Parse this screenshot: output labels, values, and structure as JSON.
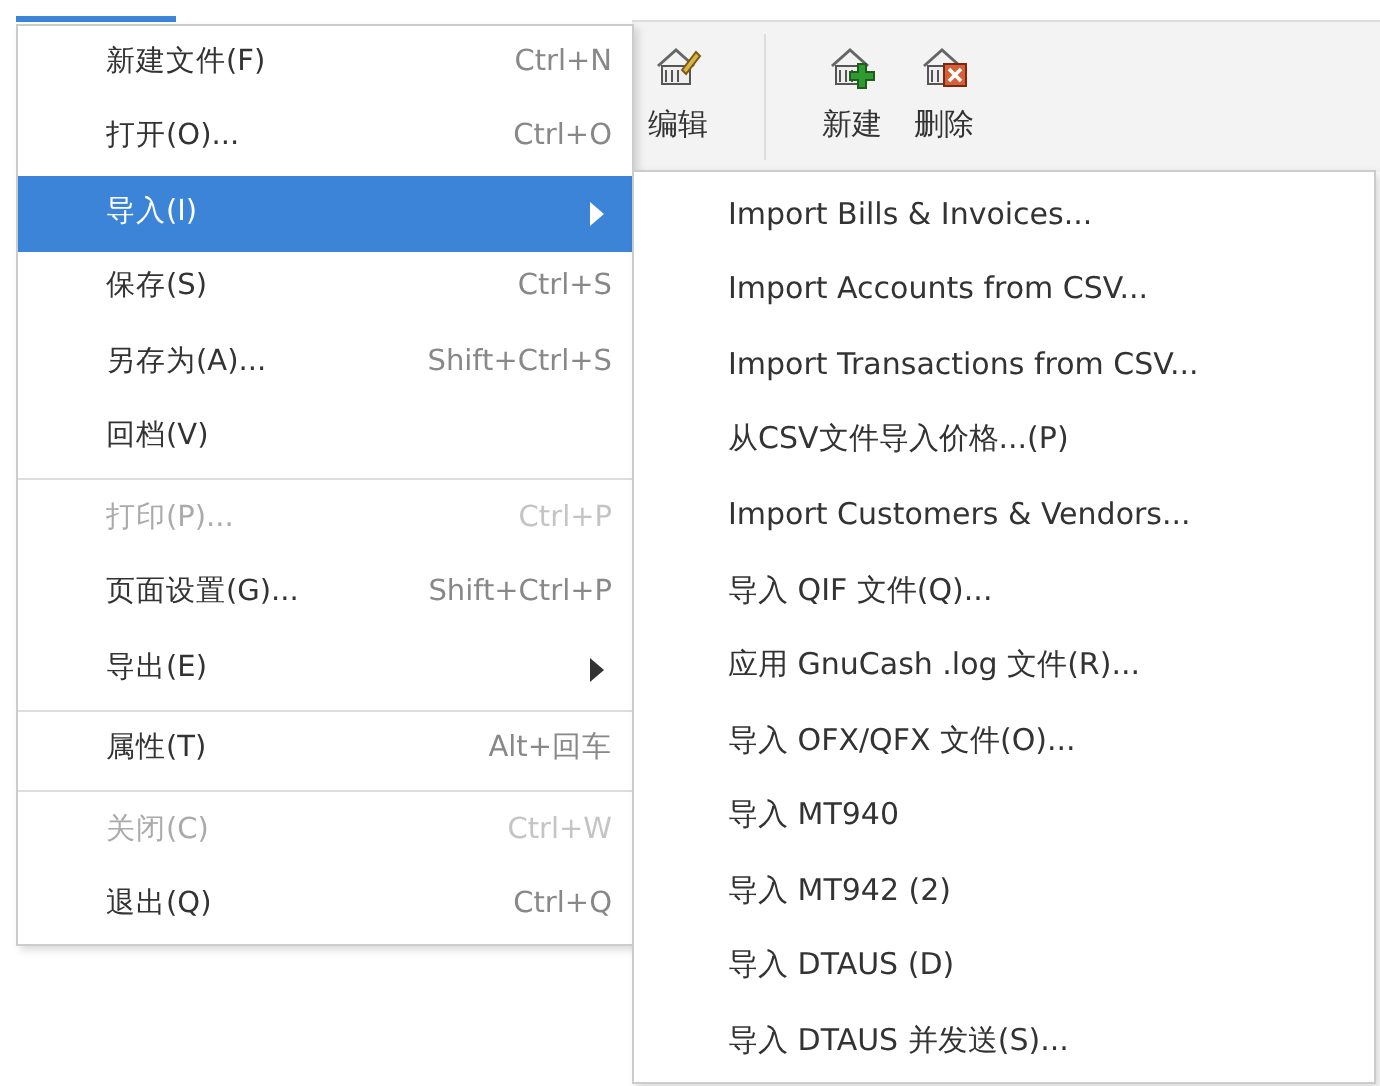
{
  "toolbar": {
    "buttons": [
      {
        "label": "编辑"
      },
      {
        "label": "新建"
      },
      {
        "label": "删除"
      }
    ]
  },
  "menu": {
    "items": [
      {
        "kind": "item",
        "label": "新建文件(F)",
        "shortcut": "Ctrl+N",
        "disabled": false,
        "selected": false
      },
      {
        "kind": "item",
        "label": "打开(O)...",
        "shortcut": "Ctrl+O",
        "disabled": false,
        "selected": false
      },
      {
        "kind": "submenu",
        "label": "导入(I)",
        "disabled": false,
        "selected": true
      },
      {
        "kind": "item",
        "label": "保存(S)",
        "shortcut": "Ctrl+S",
        "disabled": false,
        "selected": false
      },
      {
        "kind": "item",
        "label": "另存为(A)...",
        "shortcut": "Shift+Ctrl+S",
        "disabled": false,
        "selected": false
      },
      {
        "kind": "item",
        "label": "回档(V)",
        "disabled": false,
        "selected": false
      },
      {
        "kind": "separator"
      },
      {
        "kind": "item",
        "label": "打印(P)...",
        "shortcut": "Ctrl+P",
        "disabled": true,
        "selected": false
      },
      {
        "kind": "item",
        "label": "页面设置(G)...",
        "shortcut": "Shift+Ctrl+P",
        "disabled": false,
        "selected": false
      },
      {
        "kind": "submenu",
        "label": "导出(E)",
        "disabled": false,
        "selected": false
      },
      {
        "kind": "separator"
      },
      {
        "kind": "item",
        "label": "属性(T)",
        "shortcut": "Alt+回车",
        "disabled": false,
        "selected": false
      },
      {
        "kind": "separator"
      },
      {
        "kind": "item",
        "label": "关闭(C)",
        "shortcut": "Ctrl+W",
        "disabled": true,
        "selected": false
      },
      {
        "kind": "item",
        "label": "退出(Q)",
        "shortcut": "Ctrl+Q",
        "disabled": false,
        "selected": false
      }
    ]
  },
  "submenu": {
    "items": [
      {
        "label": "Import Bills & Invoices..."
      },
      {
        "label": "Import Accounts from CSV..."
      },
      {
        "label": "Import Transactions from CSV..."
      },
      {
        "label": "从CSV文件导入价格...(P)"
      },
      {
        "label": "Import Customers & Vendors..."
      },
      {
        "label": "导入 QIF 文件(Q)..."
      },
      {
        "label": "应用 GnuCash .log 文件(R)..."
      },
      {
        "label": "导入 OFX/QFX 文件(O)..."
      },
      {
        "label": "导入 MT940"
      },
      {
        "label": "导入 MT942 (2)"
      },
      {
        "label": "导入 DTAUS (D)"
      },
      {
        "label": "导入 DTAUS 并发送(S)..."
      }
    ]
  }
}
